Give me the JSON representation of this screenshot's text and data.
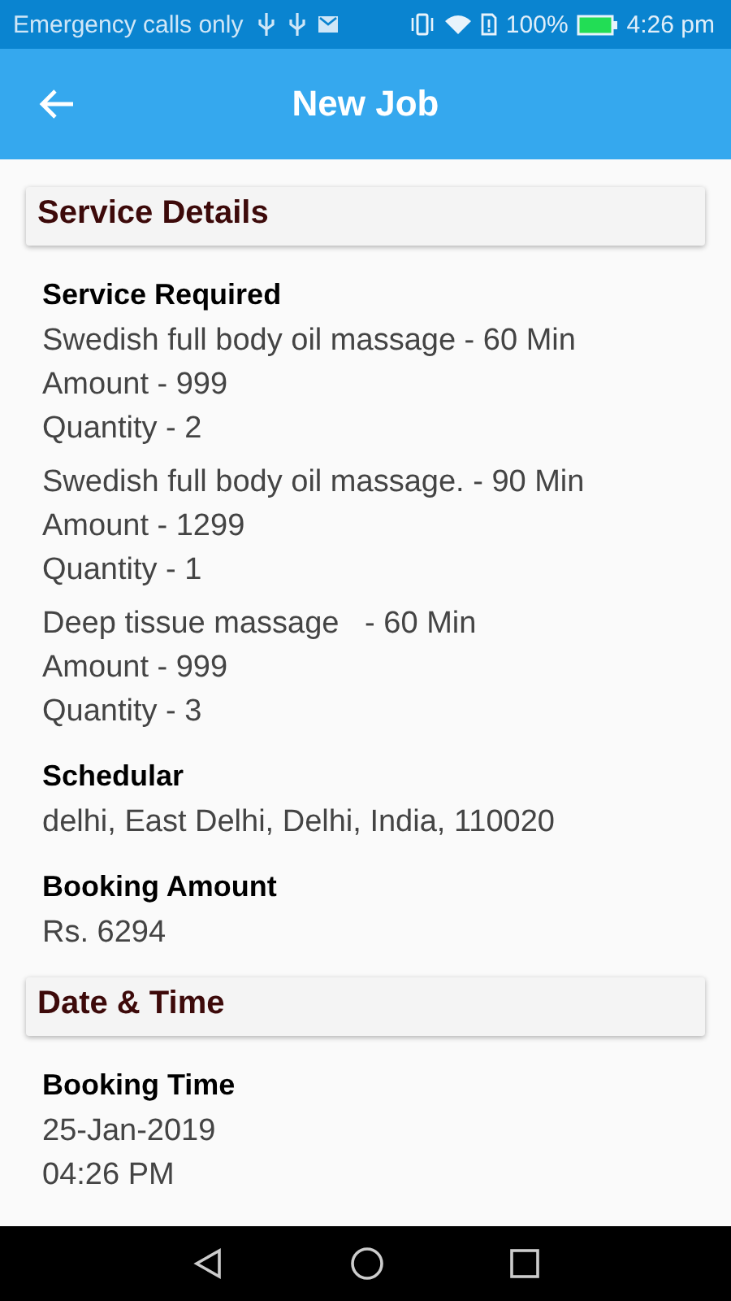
{
  "status_bar": {
    "carrier": "Emergency calls only",
    "battery": "100%",
    "time": "4:26 pm"
  },
  "app_bar": {
    "title": "New Job"
  },
  "sections": [
    {
      "title": "Service Details",
      "fields": [
        {
          "label": "Service Required",
          "groups": [
            {
              "lines": [
                "Swedish full body oil massage - 60 Min",
                "Amount - 999",
                "Quantity - 2"
              ]
            },
            {
              "lines": [
                "Swedish full body oil massage. - 90 Min",
                "Amount - 1299",
                "Quantity - 1"
              ]
            },
            {
              "lines": [
                "Deep tissue massage   - 60 Min",
                "Amount - 999",
                "Quantity - 3"
              ]
            }
          ]
        },
        {
          "label": "Schedular",
          "groups": [
            {
              "lines": [
                "delhi, East Delhi, Delhi, India, 110020"
              ]
            }
          ]
        },
        {
          "label": "Booking Amount",
          "groups": [
            {
              "lines": [
                "Rs. 6294"
              ]
            }
          ]
        }
      ]
    },
    {
      "title": "Date & Time",
      "fields": [
        {
          "label": "Booking Time",
          "groups": [
            {
              "lines": [
                "25-Jan-2019",
                "04:26 PM"
              ]
            }
          ]
        }
      ]
    }
  ]
}
